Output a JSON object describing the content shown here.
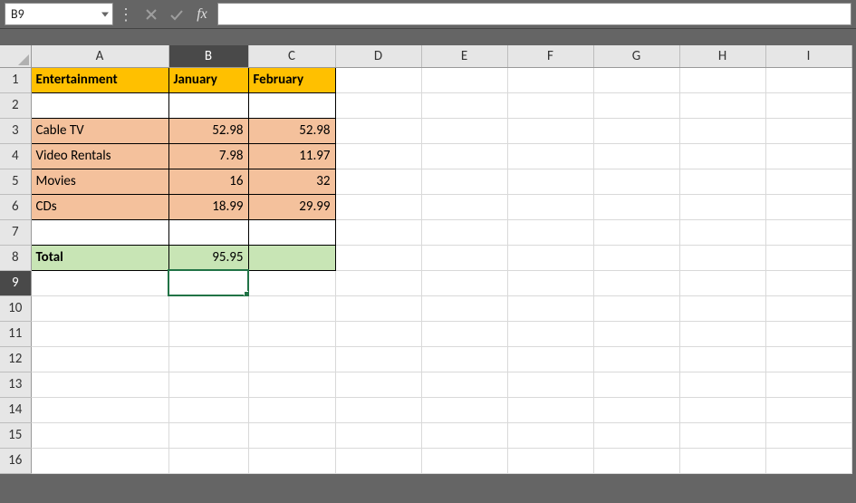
{
  "name_box": "B9",
  "formula_input": "",
  "columns": [
    "A",
    "B",
    "C",
    "D",
    "E",
    "F",
    "G",
    "H",
    "I"
  ],
  "column_widths": [
    "colw-A",
    "colw-B",
    "colw-C",
    "colw-def",
    "colw-def",
    "colw-def",
    "colw-def",
    "colw-def",
    "colw-def"
  ],
  "selected_col": "B",
  "selected_row": 9,
  "row_count": 16,
  "cells": {
    "r1": {
      "A": "Entertainment",
      "B": "January",
      "C": "February"
    },
    "r3": {
      "A": "Cable TV",
      "B": "52.98",
      "C": "52.98"
    },
    "r4": {
      "A": "Video Rentals",
      "B": "7.98",
      "C": "11.97"
    },
    "r5": {
      "A": "Movies",
      "B": "16",
      "C": "32"
    },
    "r6": {
      "A": "CDs",
      "B": "18.99",
      "C": "29.99"
    },
    "r8": {
      "A": "Total",
      "B": "95.95",
      "C": ""
    }
  },
  "fx_label": "fx",
  "sep": "⋮"
}
